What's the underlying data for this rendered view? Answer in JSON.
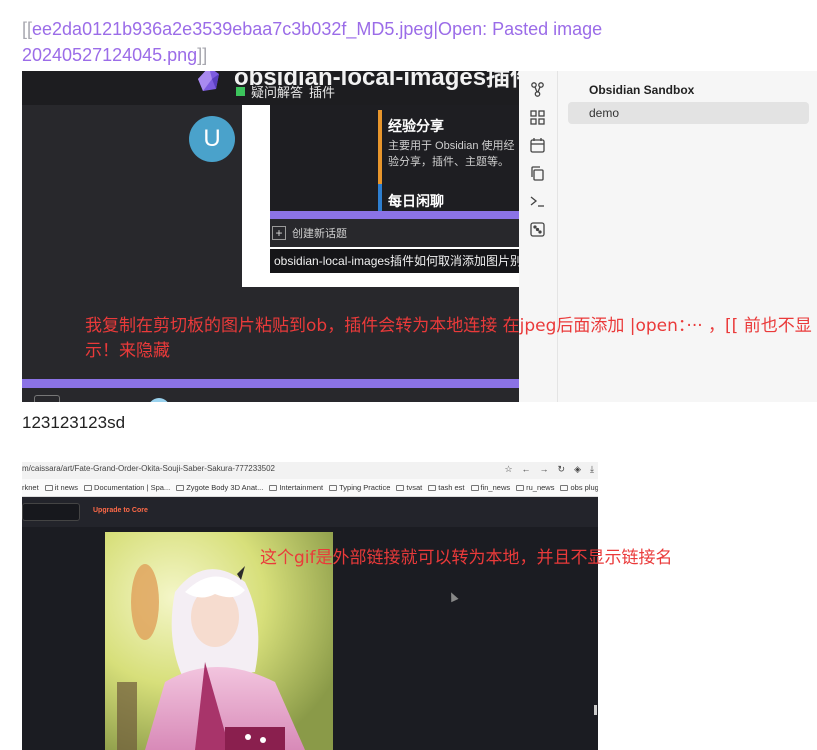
{
  "note": {
    "wikilink_open": "[[",
    "wikilink_text": "ee2da0121b936a2e3539ebaa7c3b032f_MD5.jpeg|Open: Pasted image 20240527124045.png",
    "wikilink_close": "]]",
    "plain_text": "123123123sd"
  },
  "screenshot1": {
    "title_partial": "obsidian-local-images插件",
    "tag_qa": "疑问解答",
    "tag_plugin": "插件",
    "avatar_letter": "U",
    "category1_title": "经验分享",
    "category1_desc": "主要用于 Obsidian 使用经验分享，插件、主题等。",
    "category2_title": "每日闲聊",
    "new_topic": "创建新话题",
    "topic_title": "obsidian-local-images插件如何取消添加图片别名",
    "annotation": "我复制在剪切板的图片粘贴到ob，插件会转为本地连接 在jpeg后面添加 |open：··· ，[[ 前也不显示！来隐藏"
  },
  "sidebar": {
    "vault_name": "Obsidian Sandbox",
    "files": [
      "demo"
    ],
    "ribbon_icons": [
      "graph-icon",
      "blocks-icon",
      "calendar-icon",
      "copy-icon",
      "terminal-icon",
      "dice-icon"
    ]
  },
  "screenshot2": {
    "url": "m/caissara/art/Fate-Grand-Order-Okita-Souji-Saber-Sakura-777233502",
    "bookmarks": [
      "rknet",
      "it news",
      "Documentation | Spa...",
      "Zygote Body 3D Anat...",
      "Intertainment",
      "Typing Practice",
      "tvsat",
      "tash est",
      "fin_news",
      "ru_news",
      "obs plugin"
    ],
    "upgrade_label": "Upgrade to Core",
    "annotation": "这个gif是外部链接就可以转为本地，并且不显示链接名"
  },
  "colors": {
    "link": "#9b6ce8",
    "annotation": "#ea3a3a",
    "accent_purple": "#8b73e6"
  }
}
